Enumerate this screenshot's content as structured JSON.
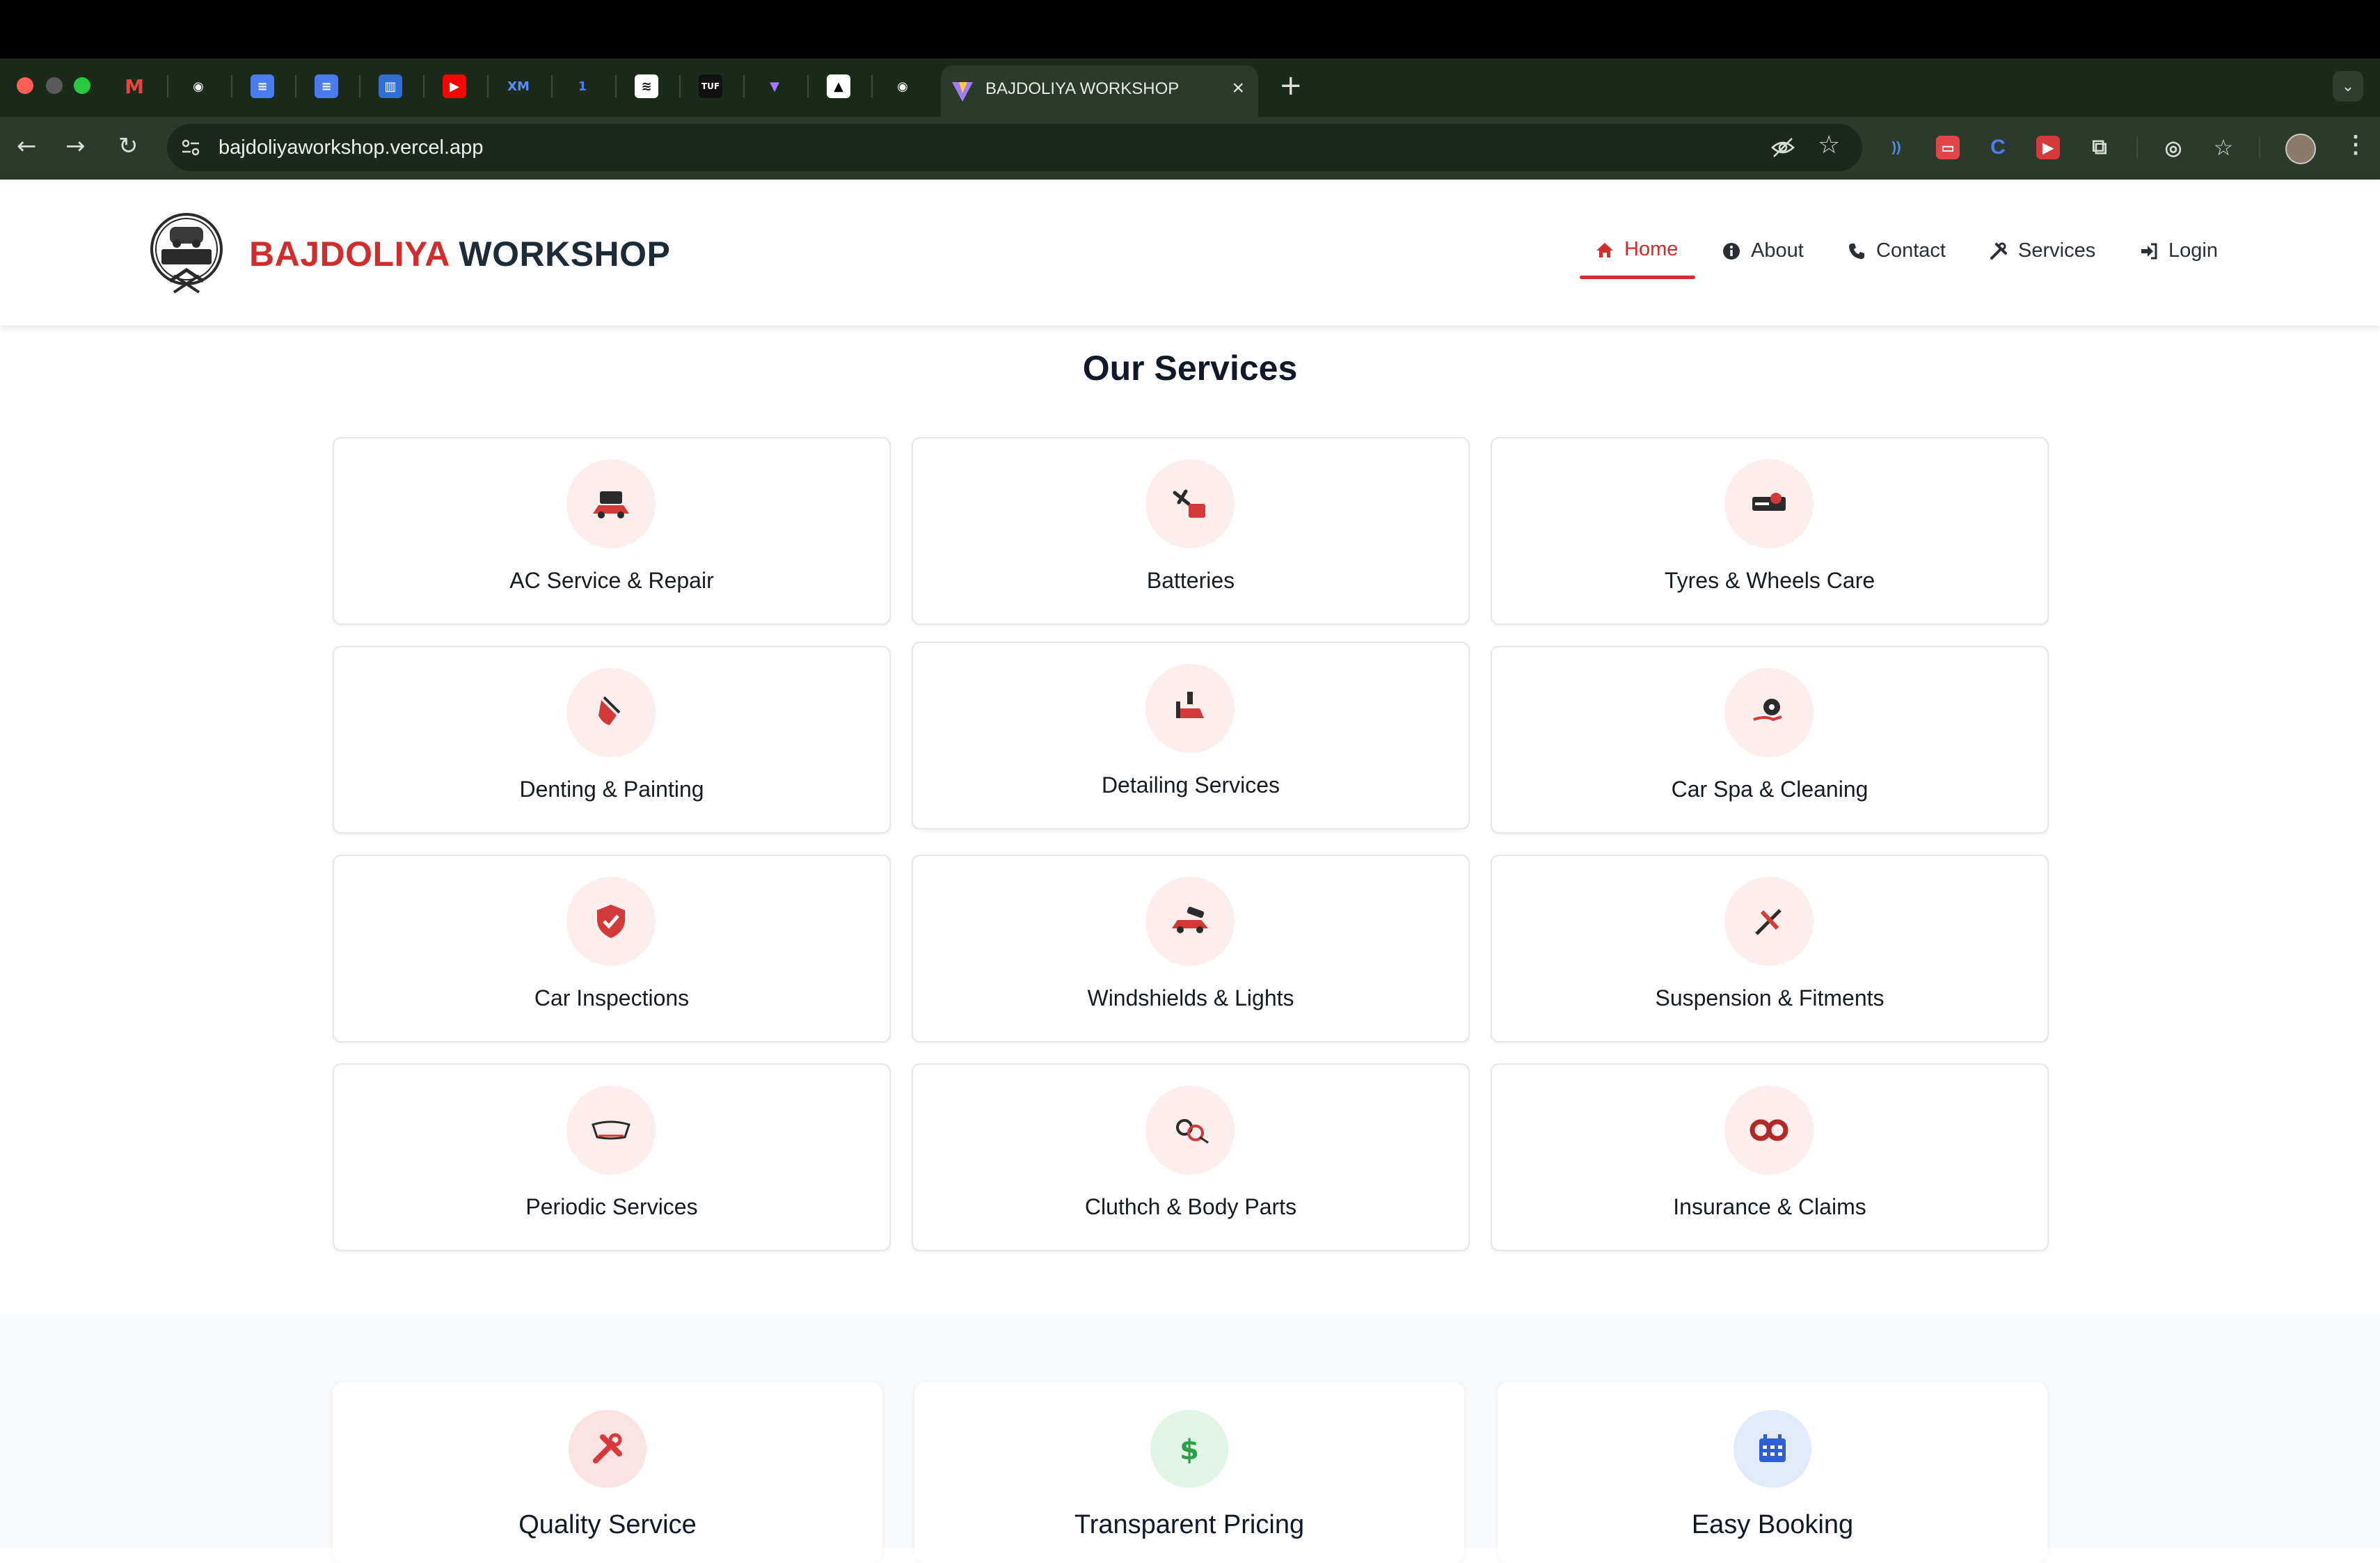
{
  "browser": {
    "active_tab_title": "BAJDOLIYA WORKSHOP",
    "url": "bajdoliyaworkshop.vercel.app",
    "pinned_tabs": [
      "gmail-icon",
      "github-icon",
      "docs-icon",
      "docs-icon",
      "trello-icon",
      "youtube-icon",
      "xm-icon",
      "linear-icon",
      "spotify-icon",
      "tuf-icon",
      "vite-icon",
      "vercel-icon",
      "github-icon"
    ]
  },
  "site": {
    "brand_first": "BAJDOLIYA",
    "brand_second": "WORKSHOP",
    "nav": [
      {
        "label": "Home",
        "icon": "home-icon",
        "active": true
      },
      {
        "label": "About",
        "icon": "info-icon"
      },
      {
        "label": "Contact",
        "icon": "phone-icon"
      },
      {
        "label": "Services",
        "icon": "tools-icon"
      },
      {
        "label": "Login",
        "icon": "login-icon"
      }
    ]
  },
  "services": {
    "title": "Our Services",
    "items": [
      {
        "label": "AC Service & Repair",
        "icon": "ac-car-icon"
      },
      {
        "label": "Batteries",
        "icon": "battery-icon"
      },
      {
        "label": "Tyres & Wheels Care",
        "icon": "tyre-icon"
      },
      {
        "label": "Denting & Painting",
        "icon": "paint-icon"
      },
      {
        "label": "Detailing Services",
        "icon": "detailing-icon"
      },
      {
        "label": "Car Spa & Cleaning",
        "icon": "spa-icon"
      },
      {
        "label": "Car Inspections",
        "icon": "shield-check-icon"
      },
      {
        "label": "Windshields & Lights",
        "icon": "windshield-icon"
      },
      {
        "label": "Suspension & Fitments",
        "icon": "suspension-icon"
      },
      {
        "label": "Periodic Services",
        "icon": "periodic-icon"
      },
      {
        "label": "Cluthch & Body Parts",
        "icon": "clutch-icon"
      },
      {
        "label": "Insurance & Claims",
        "icon": "insurance-icon"
      }
    ]
  },
  "features": [
    {
      "title": "Quality Service",
      "icon": "tools-icon",
      "color": "#d63a3a"
    },
    {
      "title": "Transparent Pricing",
      "icon": "dollar-icon",
      "color": "#2f9e4a"
    },
    {
      "title": "Easy Booking",
      "icon": "calendar-icon",
      "color": "#2f5fd6"
    }
  ],
  "colors": {
    "brand_red": "#cf2e2e",
    "brand_dark": "#1f2a37",
    "icon_bg": "#fdeeee"
  }
}
